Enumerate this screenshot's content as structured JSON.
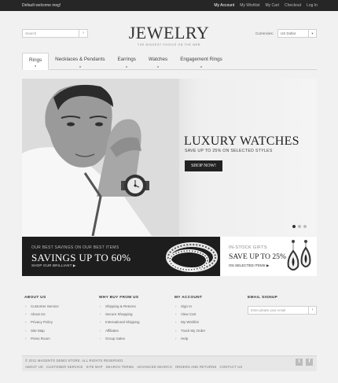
{
  "topbar": {
    "welcome": "Default welcome msg!",
    "links": [
      "My Account",
      "My Wishlist",
      "My Cart",
      "Checkout",
      "Log In"
    ]
  },
  "search": {
    "placeholder": "Search",
    "button": "›"
  },
  "logo": {
    "name": "JEWELRY",
    "tagline": "THE BIGGEST CHOICE ON THE WEB"
  },
  "currency": {
    "label": "Currencies:",
    "value": "US Dollar"
  },
  "nav": {
    "tabs": [
      "Rings",
      "Necklaces & Pendants",
      "Earrings",
      "Watches",
      "Engagement Rings"
    ],
    "active": "Rings"
  },
  "slider": {
    "headline": "LUXURY WATCHES",
    "subline": "SAVE UP TO 25% ON SELECTED STYLES",
    "button": "SHOP NOW!",
    "slides": 3,
    "current_slide": 1
  },
  "banner_left": {
    "line1": "OUR BEST SAVINGS ON OUR BEST ITEMS",
    "line2": "SAVINGS UP TO 60%",
    "line3": "SHOP OUR BRILLIANT"
  },
  "banner_right": {
    "line1": "IN-STOCK GIFTS",
    "line2": "SAVE UP TO 25%",
    "line3": "ON SELECTED ITEMS"
  },
  "footer": {
    "about": {
      "heading": "ABOUT US",
      "items": [
        "Customer Service",
        "About Us",
        "Privacy Policy",
        "Site Map",
        "Press Room"
      ]
    },
    "why": {
      "heading": "WHY BUY FROM US",
      "items": [
        "Shipping & Returns",
        "Secure Shopping",
        "International Shipping",
        "Affiliates",
        "Group Sales"
      ]
    },
    "account": {
      "heading": "MY ACCOUNT",
      "items": [
        "Sign In",
        "View Cart",
        "My Wishlist",
        "Track My Order",
        "Help"
      ]
    },
    "signup": {
      "heading": "EMAIL SIGNUP",
      "placeholder": "Enter please your email"
    }
  },
  "bottom": {
    "copyright": "© 2011 MAGENTO DEMO STORE. ALL RIGHTS RESERVED.",
    "links": [
      "ABOUT US",
      "CUSTOMER SERVICE",
      "SITE MAP",
      "SEARCH TERMS",
      "ADVANCED SEARCH",
      "ORDERS AND RETURNS",
      "CONTACT US"
    ],
    "social": [
      "t",
      "f"
    ]
  },
  "colors": {
    "dark": "#262626",
    "banner_dark": "#1d1d1d",
    "accent_bg": "#f1f1f1"
  }
}
